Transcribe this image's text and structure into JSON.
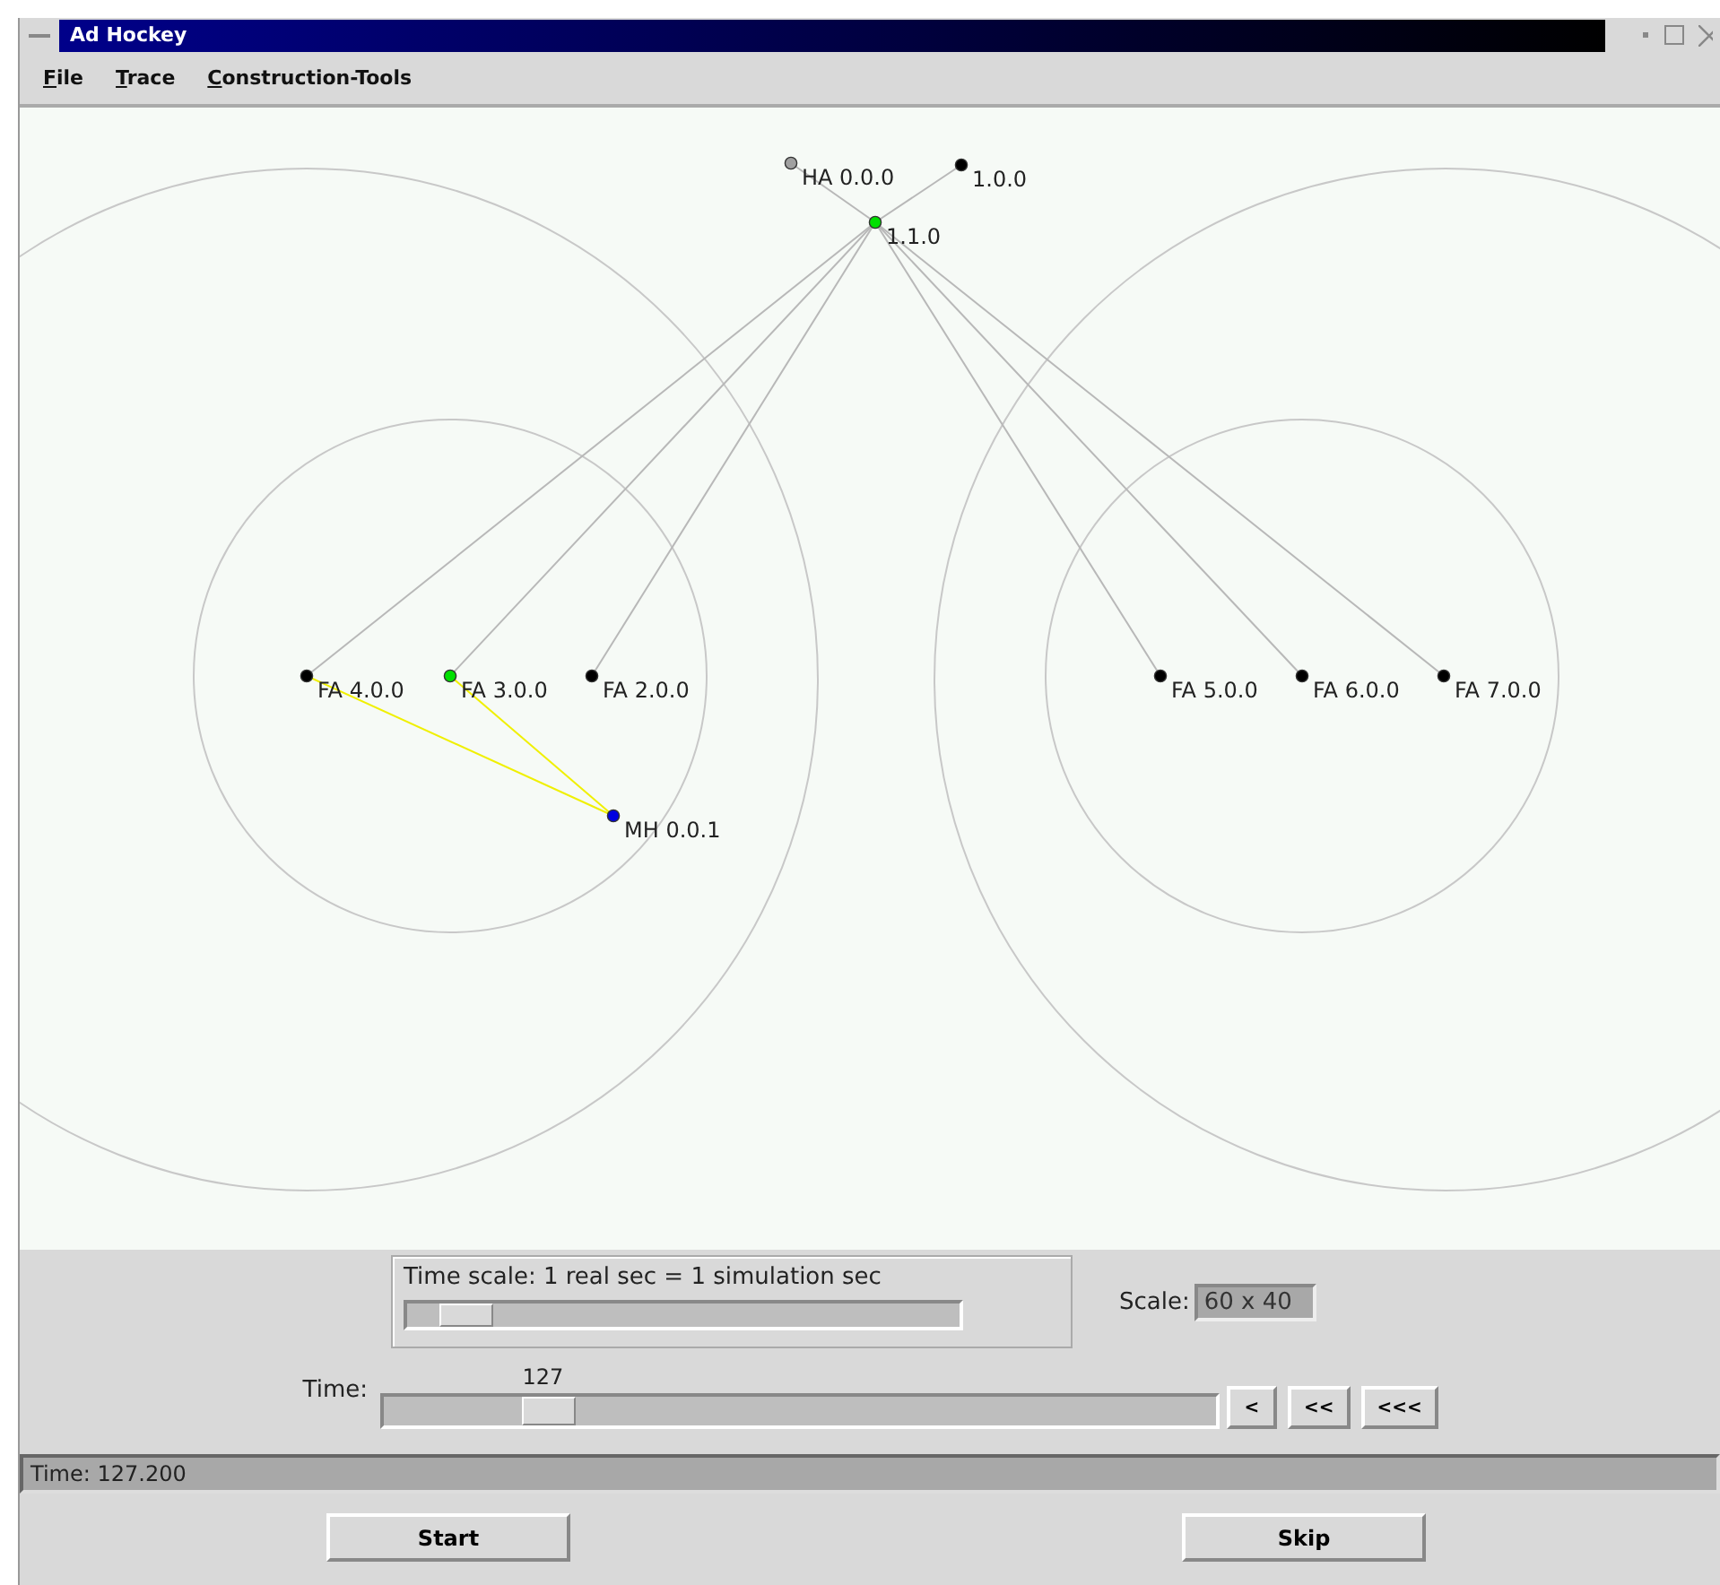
{
  "window": {
    "title": "Ad Hockey"
  },
  "menu": [
    {
      "label": "File"
    },
    {
      "label": "Trace"
    },
    {
      "label": "Construction-Tools"
    }
  ],
  "canvas": {
    "nodes": [
      {
        "label": "HA 0.0.0",
        "color": "#a0a0a0"
      },
      {
        "label": "1.0.0",
        "color": "#000000"
      },
      {
        "label": "1.1.0",
        "color": "#00e000"
      },
      {
        "label": "FA 4.0.0",
        "color": "#000000"
      },
      {
        "label": "FA 3.0.0",
        "color": "#00e000"
      },
      {
        "label": "FA 2.0.0",
        "color": "#000000"
      },
      {
        "label": "MH 0.0.1",
        "color": "#0000e0"
      },
      {
        "label": "FA 5.0.0",
        "color": "#000000"
      },
      {
        "label": "FA 6.0.0",
        "color": "#000000"
      },
      {
        "label": "FA 7.0.0",
        "color": "#000000"
      }
    ],
    "links": [
      {
        "kind": "wired"
      },
      {
        "kind": "wired"
      },
      {
        "kind": "wired"
      },
      {
        "kind": "wired"
      },
      {
        "kind": "wired"
      },
      {
        "kind": "wired"
      },
      {
        "kind": "wired"
      },
      {
        "kind": "wired"
      },
      {
        "kind": "wireless"
      },
      {
        "kind": "wireless"
      }
    ]
  },
  "time_scale": {
    "label": "Time scale:  1 real sec = 1 simulation sec",
    "level": 0.06
  },
  "scale": {
    "label": "Scale:",
    "value": "60 x 40"
  },
  "time": {
    "label": "Time:",
    "reading": "127",
    "level": 0.165
  },
  "step_buttons": [
    "<",
    "<<",
    "<<<"
  ],
  "status_bar": "Time: 127.200",
  "buttons": [
    "Start",
    "Skip"
  ]
}
